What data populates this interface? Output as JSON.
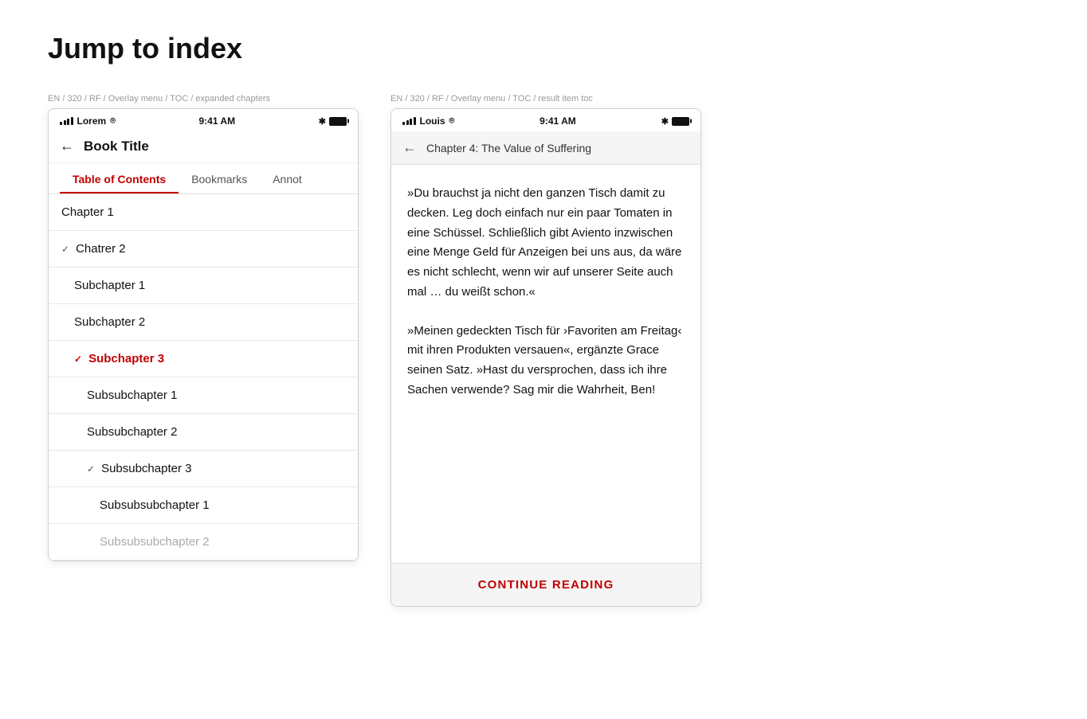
{
  "page": {
    "title": "Jump to index"
  },
  "left_screen": {
    "breadcrumb": "EN / 320 / RF / Overlay menu / TOC / expanded chapters",
    "status_bar": {
      "carrier": "Lorem",
      "time": "9:41 AM"
    },
    "nav": {
      "back_label": "←",
      "title": "Book Title"
    },
    "tabs": [
      {
        "label": "Table of Contents",
        "active": true
      },
      {
        "label": "Bookmarks",
        "active": false
      },
      {
        "label": "Annot",
        "active": false
      }
    ],
    "toc_items": [
      {
        "level": "chapter",
        "label": "Chapter 1",
        "expanded": false,
        "active": false
      },
      {
        "level": "chapter",
        "label": "Chatrer 2",
        "expanded": true,
        "active": false,
        "has_chevron": true
      },
      {
        "level": "subchapter",
        "label": "Subchapter 1",
        "expanded": false,
        "active": false
      },
      {
        "level": "subchapter",
        "label": "Subchapter 2",
        "expanded": false,
        "active": false
      },
      {
        "level": "subchapter",
        "label": "Subchapter 3",
        "expanded": true,
        "active": true,
        "has_chevron": true
      },
      {
        "level": "subsubchapter",
        "label": "Subsubchapter 1",
        "expanded": false,
        "active": false
      },
      {
        "level": "subsubchapter",
        "label": "Subsubchapter 2",
        "expanded": false,
        "active": false
      },
      {
        "level": "subsubchapter",
        "label": "Subsubchapter 3",
        "expanded": true,
        "active": false,
        "has_chevron": true
      },
      {
        "level": "subsubsubchapter",
        "label": "Subsubsubchapter 1",
        "expanded": false,
        "active": false
      },
      {
        "level": "subsubsubchapter",
        "label": "Subsubsubchapter 2",
        "expanded": false,
        "active": false
      }
    ]
  },
  "right_screen": {
    "breadcrumb": "EN / 320 / RF / Overlay menu / TOC / result item toc",
    "status_bar": {
      "carrier": "Louis",
      "time": "9:41 AM"
    },
    "nav": {
      "back_label": "←",
      "title": "Chapter 4: The Value of Suffering"
    },
    "paragraphs": [
      "»Du brauchst ja nicht den ganzen Tisch damit zu decken. Leg doch einfach nur ein paar Tomaten in eine Schüssel. Schließlich gibt Aviento inzwischen eine Menge Geld für Anzeigen bei uns aus, da wäre es nicht schlecht, wenn wir auf unserer Seite auch mal … du weißt schon.«",
      "»Meinen gedeckten Tisch für ›Favoriten am Freitag‹ mit ihren Produkten versauen«, ergänzte Grace seinen Satz. »Hast du versprochen, dass ich ihre Sachen verwende? Sag mir die Wahrheit, Ben!"
    ],
    "continue_button": "CONTINUE READING"
  }
}
